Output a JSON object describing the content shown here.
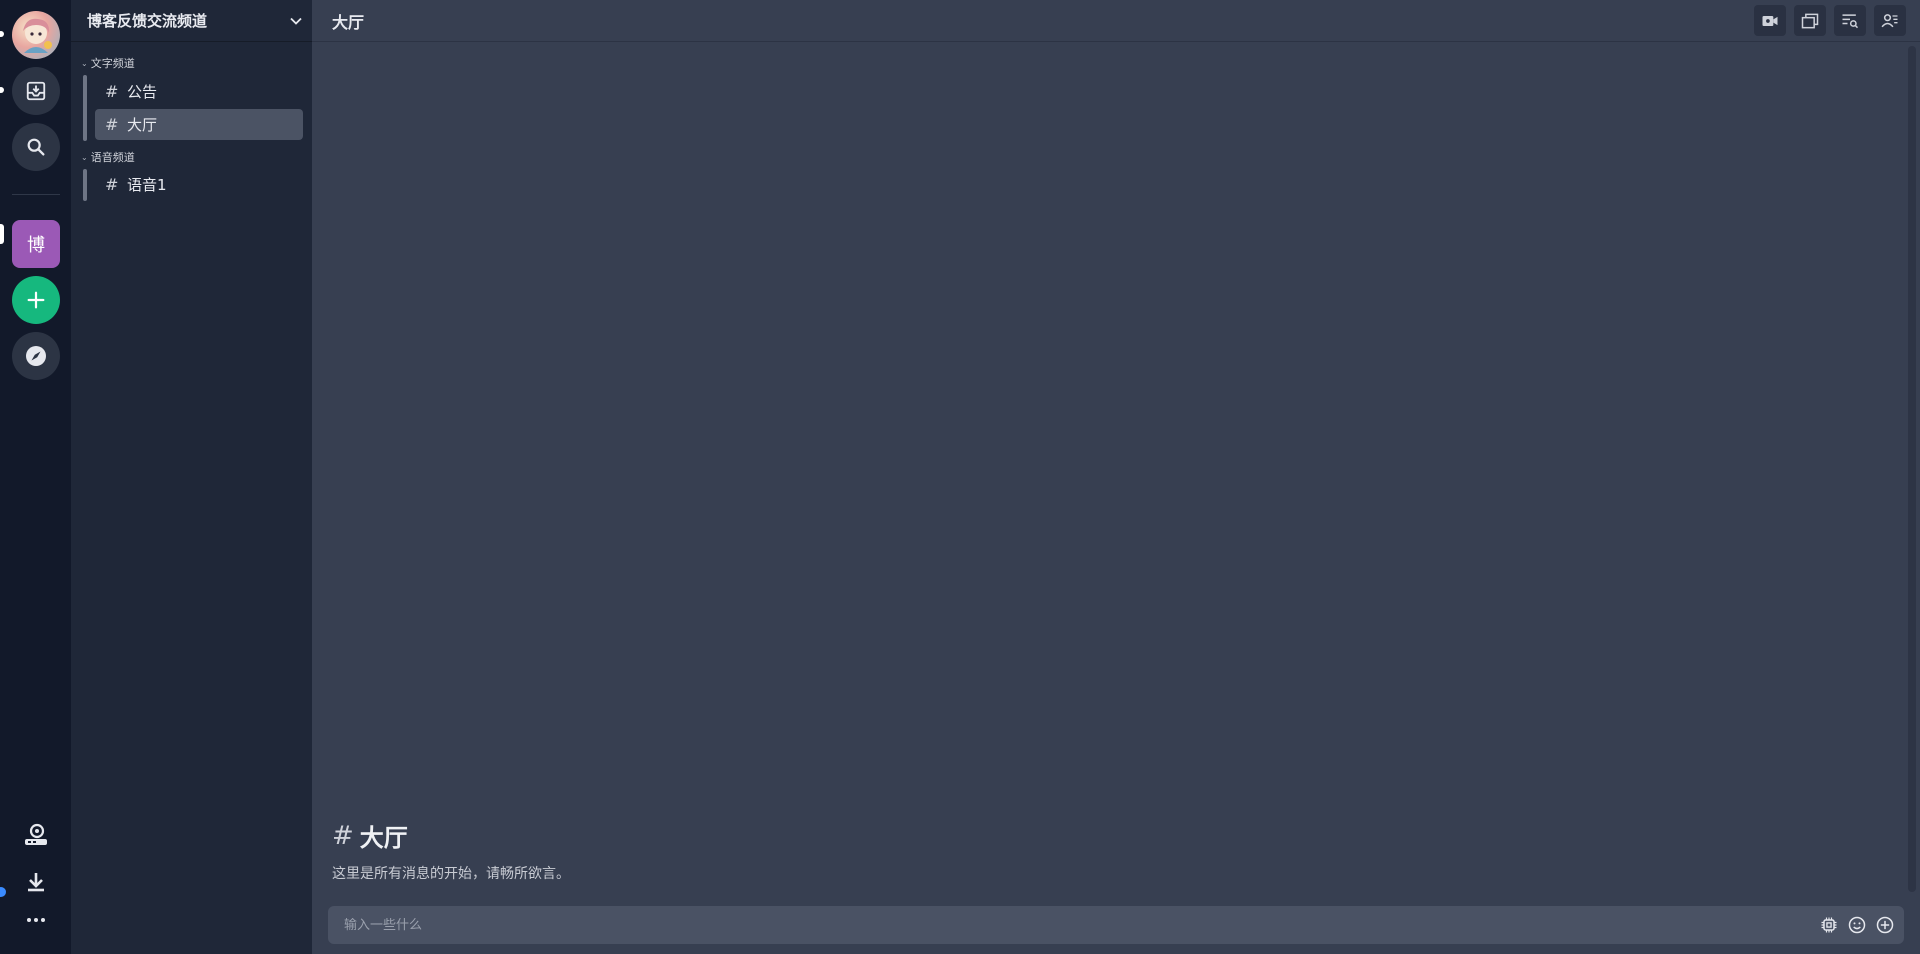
{
  "server": {
    "name": "博客反馈交流频道",
    "tile_label": "博"
  },
  "categories": [
    {
      "label": "文字频道",
      "channels": [
        {
          "label": "公告"
        },
        {
          "label": "大厅",
          "active": true
        }
      ]
    },
    {
      "label": "语音频道",
      "channels": [
        {
          "label": "语音1"
        }
      ]
    }
  ],
  "header": {
    "channel": "大厅"
  },
  "welcome": {
    "hash": "#",
    "title": "大厅",
    "subtitle": "这里是所有消息的开始，请畅所欲言。"
  },
  "composer": {
    "placeholder": "输入一些什么"
  },
  "hash_symbol": "#",
  "colors": {
    "rail_bg": "#12192a",
    "sidebar_bg": "#1f2738",
    "main_bg": "#373f51",
    "server_tile": "#9b59b6",
    "add_button": "#16b87e",
    "notification_dot": "#3a8bff"
  },
  "icons": {
    "topbar": [
      "video-icon",
      "window-icon",
      "search-list-icon",
      "members-icon"
    ],
    "composer": [
      "chip-icon",
      "emoji-icon",
      "plus-circle-icon"
    ]
  }
}
